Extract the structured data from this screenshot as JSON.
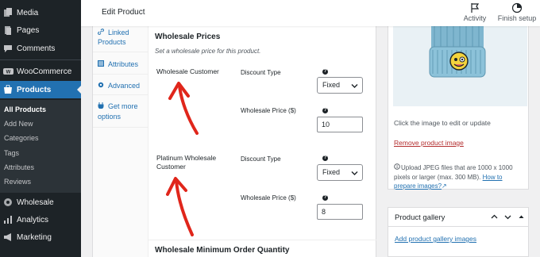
{
  "sidebar": {
    "items": [
      {
        "label": "Media",
        "icon": "media-icon"
      },
      {
        "label": "Pages",
        "icon": "pages-icon"
      },
      {
        "label": "Comments",
        "icon": "comments-icon"
      },
      {
        "label": "WooCommerce",
        "icon": "woocommerce-icon"
      },
      {
        "label": "Products",
        "icon": "products-icon"
      },
      {
        "label": "Wholesale",
        "icon": "wholesale-icon"
      },
      {
        "label": "Analytics",
        "icon": "analytics-icon"
      },
      {
        "label": "Marketing",
        "icon": "marketing-icon"
      }
    ],
    "submenu": [
      "All Products",
      "Add New",
      "Categories",
      "Tags",
      "Attributes",
      "Reviews"
    ],
    "active_item": "Products",
    "active_sub": "All Products"
  },
  "topbar": {
    "title": "Edit Product",
    "activity": "Activity",
    "finish_setup": "Finish setup"
  },
  "tabs": [
    {
      "label": "Linked Products",
      "icon": "link-icon"
    },
    {
      "label": "Attributes",
      "icon": "attributes-icon"
    },
    {
      "label": "Advanced",
      "icon": "gear-icon"
    },
    {
      "label": "Get more options",
      "icon": "plugin-icon"
    }
  ],
  "wholesale": {
    "title": "Wholesale Prices",
    "description": "Set a wholesale price for this product.",
    "discount_type_label": "Discount Type",
    "price_label": "Wholesale Price ($)",
    "help_glyph": "?",
    "roles": [
      {
        "name": "Wholesale Customer",
        "discount_type": "Fixed",
        "price": "10"
      },
      {
        "name": "Platinum Wholesale Customer",
        "discount_type": "Fixed",
        "price": "8"
      }
    ],
    "min_qty_title": "Wholesale Minimum Order Quantity"
  },
  "product_image": {
    "hint": "Click the image to edit or update",
    "remove": "Remove product image",
    "note": "Upload JPEG files that are 1000 x 1000 pixels or larger (max. 300 MB).",
    "note_link": "How to prepare images?"
  },
  "gallery": {
    "title": "Product gallery",
    "add_link": "Add product gallery images"
  },
  "colors": {
    "admin_bg": "#1d2327",
    "accent": "#2271b1",
    "annotation_arrow": "#e0261b",
    "danger_link": "#b32d2e"
  }
}
